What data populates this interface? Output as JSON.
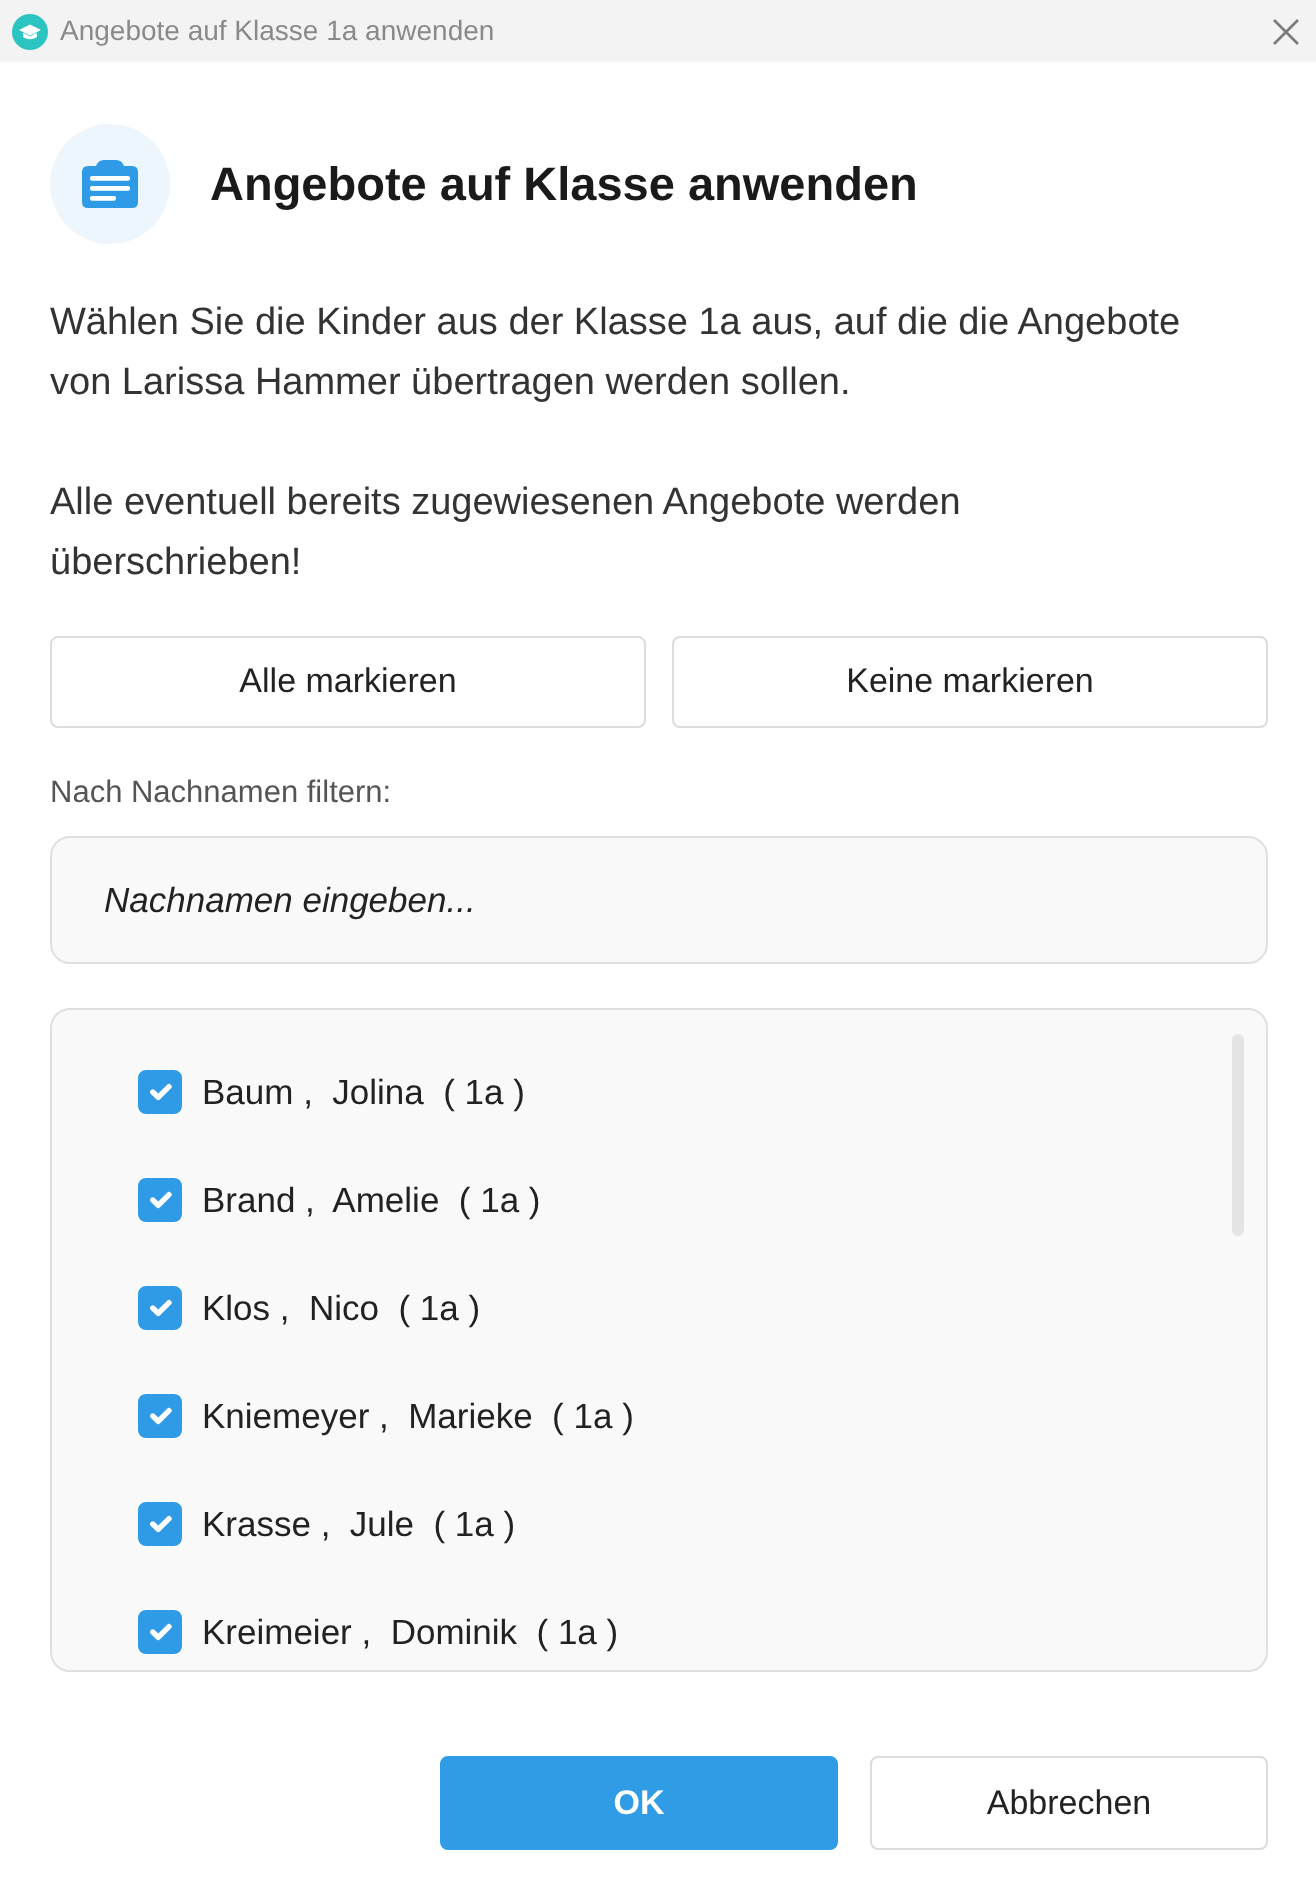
{
  "window": {
    "title": "Angebote auf Klasse 1a anwenden"
  },
  "header": {
    "title": "Angebote auf Klasse anwenden"
  },
  "paragraphs": [
    "Wählen Sie die Kinder aus der Klasse 1a aus, auf die die Angebote von Larissa Hammer übertragen werden sollen.",
    "Alle eventuell bereits zugewiesenen Angebote werden überschrieben!"
  ],
  "selection_buttons": [
    "Alle markieren",
    "Keine markieren"
  ],
  "filter": {
    "label": "Nach Nachnamen filtern:",
    "placeholder": "Nachnamen eingeben..."
  },
  "students": [
    {
      "label": "Baum ,  Jolina  ( 1a )",
      "checked": true
    },
    {
      "label": "Brand ,  Amelie  ( 1a )",
      "checked": true
    },
    {
      "label": "Klos ,  Nico  ( 1a )",
      "checked": true
    },
    {
      "label": "Kniemeyer ,  Marieke  ( 1a )",
      "checked": true
    },
    {
      "label": "Krasse ,  Jule  ( 1a )",
      "checked": true
    },
    {
      "label": "Kreimeier ,  Dominik  ( 1a )",
      "checked": true
    }
  ],
  "footer_buttons": [
    {
      "label": "OK",
      "kind": "primary"
    },
    {
      "label": "Abbrechen",
      "kind": "secondary"
    }
  ]
}
